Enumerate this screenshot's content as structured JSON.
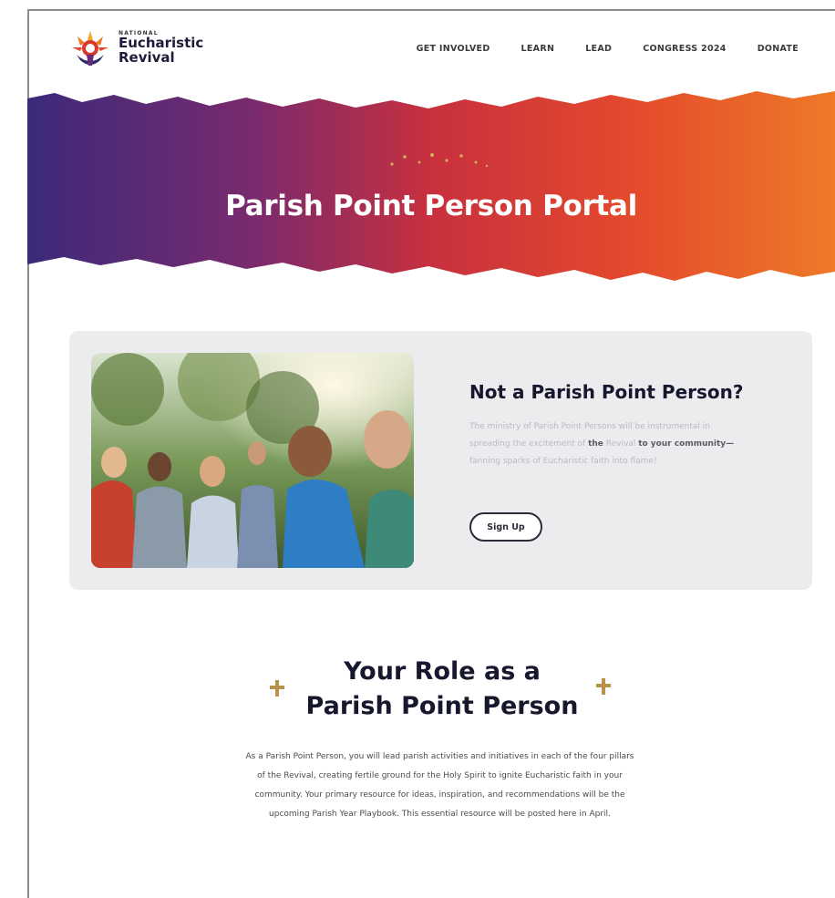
{
  "header": {
    "logo_small": "NATIONAL",
    "logo_line1": "Eucharistic",
    "logo_line2": "Revival",
    "nav": [
      {
        "label": "GET INVOLVED"
      },
      {
        "label": "LEARN"
      },
      {
        "label": "LEAD"
      },
      {
        "label": "CONGRESS 2024"
      },
      {
        "label": "DONATE"
      }
    ]
  },
  "hero": {
    "title": "Parish Point Person Portal"
  },
  "promo_card": {
    "title": "Not a Parish Point Person?",
    "body_faded_1": "The ministry of Parish Point Persons will be instrumental in",
    "body_2a": "spreading the excitement of ",
    "body_2b": "the",
    "body_2c": " Revival ",
    "body_2d": "to your community—",
    "body_faded_3": "fanning sparks of Eucharistic faith into flame!",
    "button_label": "Sign Up"
  },
  "role_section": {
    "title_line1": "Your Role as a",
    "title_line2": "Parish Point Person",
    "body_line1": "As a Parish Point Person, you will lead parish activities and initiatives in each of the four pillars",
    "body_line2": "of the Revival, creating fertile ground for the Holy Spirit to ignite Eucharistic faith in your",
    "body_line3": "community. Your primary resource for ideas, inspiration, and recommendations will be the",
    "body_line4": "upcoming Parish Year Playbook. This essential resource will be posted here in April."
  },
  "colors": {
    "hero_gradient": [
      "#3b2a7a",
      "#7a2a6e",
      "#c8303e",
      "#e44a2c",
      "#ee7a27"
    ],
    "card_bg": "#ececee",
    "gold_accent": "#b8924a",
    "heading": "#17172d"
  },
  "icons": {
    "logo": "sunburst-monstrance-icon",
    "sparkles": "sparkle-dots-icon",
    "cross": "gold-cross-icon"
  }
}
